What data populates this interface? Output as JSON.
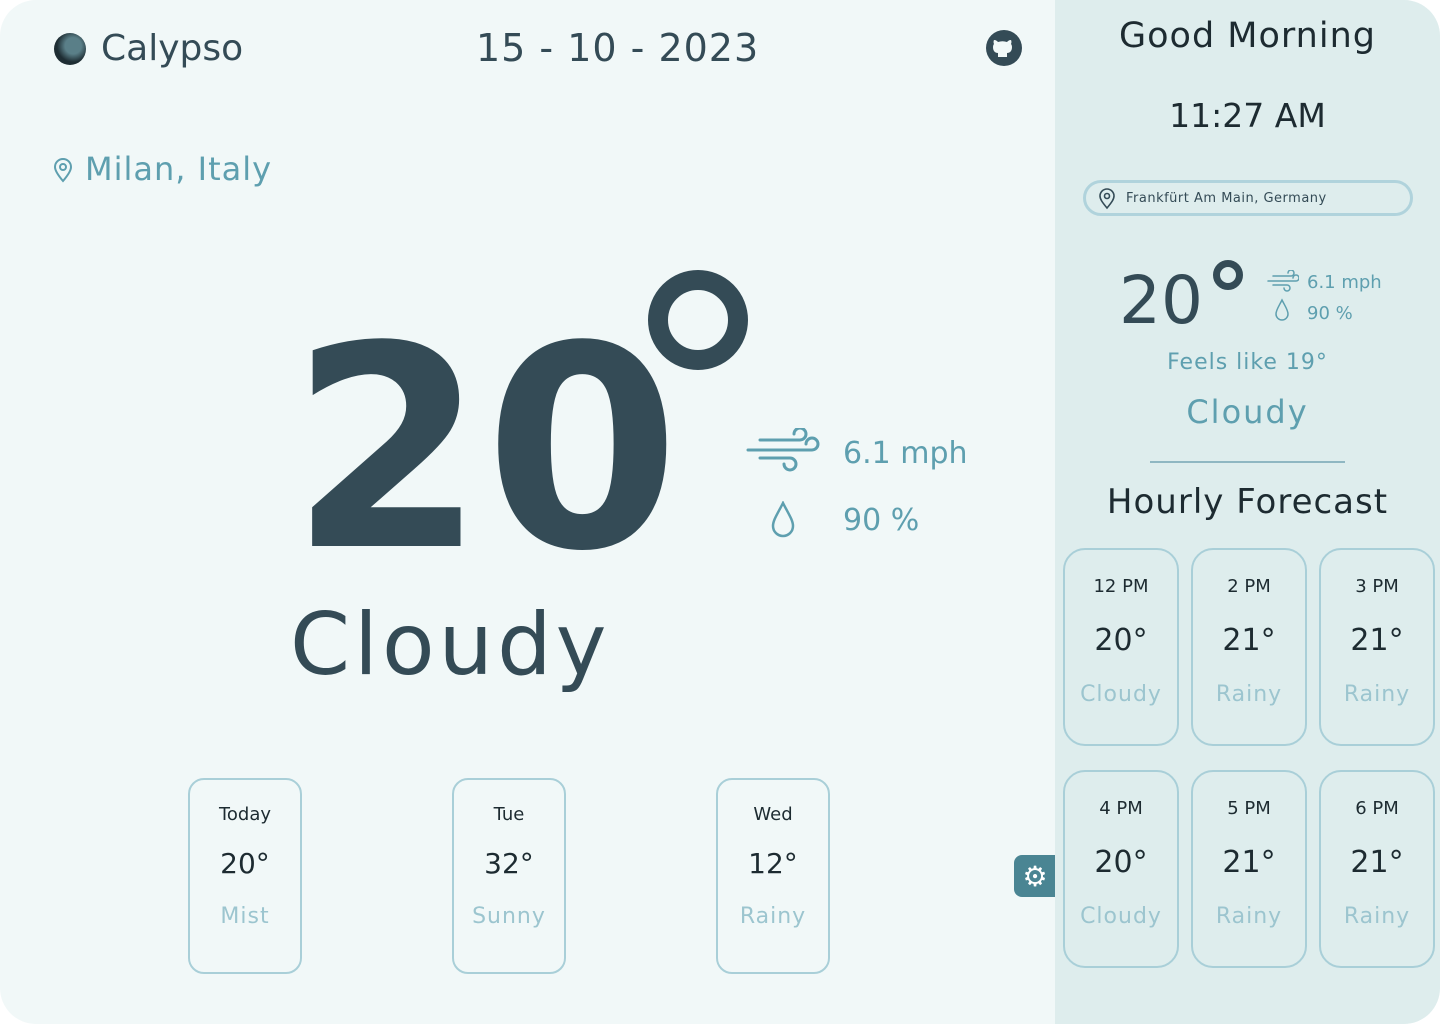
{
  "header": {
    "app_name": "Calypso",
    "date": "15 - 10 - 2023"
  },
  "main": {
    "location": "Milan, Italy",
    "temperature": "20",
    "degree_symbol": "°",
    "condition": "Cloudy",
    "wind": "6.1 mph",
    "humidity": "90 %"
  },
  "daily": [
    {
      "day": "Today",
      "temp": "20°",
      "condition": "Mist"
    },
    {
      "day": "Tue",
      "temp": "32°",
      "condition": "Sunny"
    },
    {
      "day": "Wed",
      "temp": "12°",
      "condition": "Rainy"
    }
  ],
  "sidebar": {
    "greeting": "Good Morning",
    "time": "11:27 AM",
    "search_value": "Frankfürt Am Main, Germany",
    "temperature": "20",
    "degree_symbol": "°",
    "wind": "6.1 mph",
    "humidity": "90 %",
    "feels_like": "Feels like 19°",
    "condition": "Cloudy",
    "hourly_title": "Hourly Forecast",
    "hourly": [
      {
        "time": "12 PM",
        "temp": "20°",
        "condition": "Cloudy"
      },
      {
        "time": "2 PM",
        "temp": "21°",
        "condition": "Rainy"
      },
      {
        "time": "3 PM",
        "temp": "21°",
        "condition": "Rainy"
      },
      {
        "time": "4 PM",
        "temp": "20°",
        "condition": "Cloudy"
      },
      {
        "time": "5 PM",
        "temp": "21°",
        "condition": "Rainy"
      },
      {
        "time": "6 PM",
        "temp": "21°",
        "condition": "Rainy"
      }
    ]
  }
}
